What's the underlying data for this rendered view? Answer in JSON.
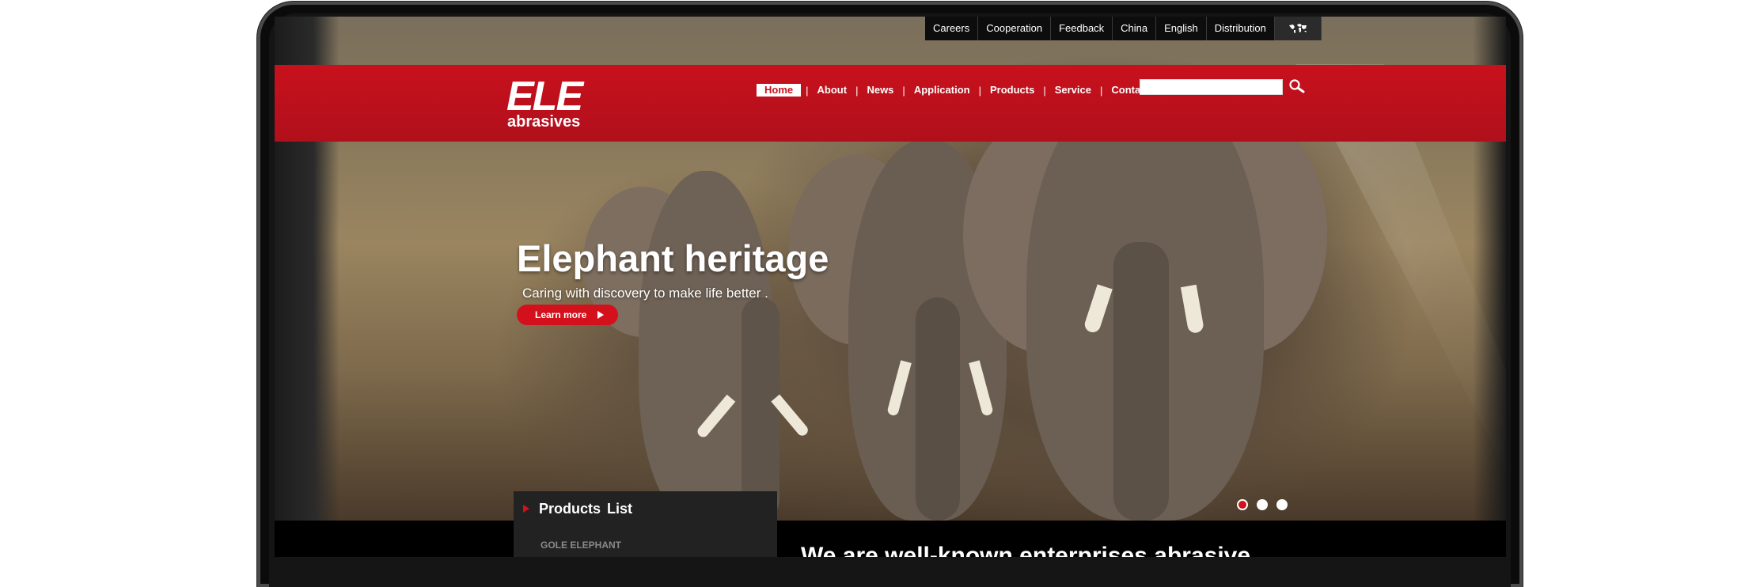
{
  "topbar": {
    "items": [
      "Careers",
      "Cooperation",
      "Feedback",
      "China",
      "English",
      "Distribution"
    ],
    "globe_icon": "world-map-icon"
  },
  "brand": {
    "logo_main": "ELE",
    "logo_sub": "abrasives"
  },
  "nav": {
    "items": [
      "Home",
      "About",
      "News",
      "Application",
      "Products",
      "Service",
      "Contact"
    ],
    "active": "Home"
  },
  "search": {
    "placeholder": "",
    "icon": "search-icon"
  },
  "slide": {
    "title": "Elephant heritage",
    "subtitle": "Caring with discovery to make life better .",
    "cta_label": "Learn more",
    "dots": 3,
    "active_dot": 0
  },
  "products": {
    "title": "Products  List",
    "first_item": "GOLE ELEPHANT"
  },
  "main": {
    "headline": "We are well-known enterprises abrasive"
  },
  "colors": {
    "brand_red": "#c8111d",
    "topbar_bg": "#0d0d0d",
    "panel_bg": "#222222"
  }
}
